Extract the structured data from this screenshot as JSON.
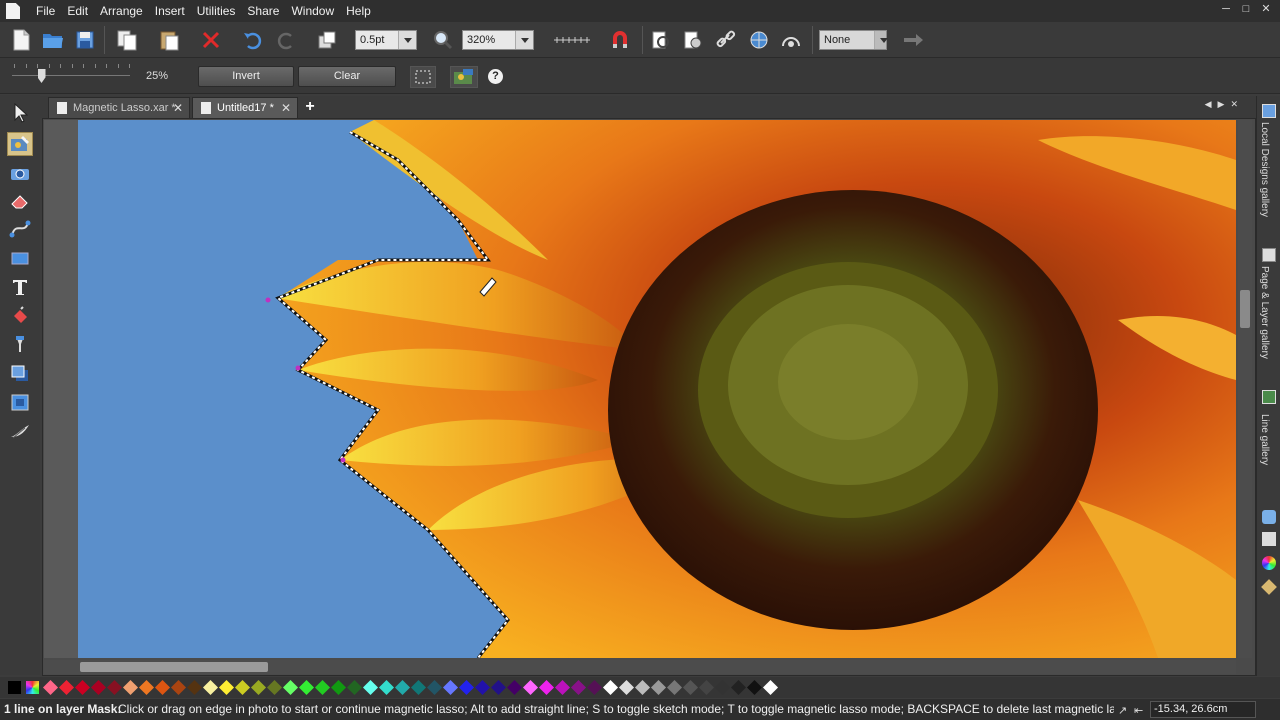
{
  "menu": [
    "File",
    "Edit",
    "Arrange",
    "Insert",
    "Utilities",
    "Share",
    "Window",
    "Help"
  ],
  "toolbar": {
    "line_width": "0.5pt",
    "zoom": "320%",
    "fill_none": "None"
  },
  "lasso_options": {
    "feather_value": 0.25,
    "feather_label": "25%",
    "invert_label": "Invert",
    "clear_label": "Clear",
    "help_glyph": "?"
  },
  "tabs": [
    {
      "label": "Magnetic Lasso.xar *"
    },
    {
      "label": "Untitled17 *"
    }
  ],
  "add_tab_glyph": "+",
  "galleries": {
    "local_designs": "Local Designs gallery",
    "page_layer": "Page & Layer gallery",
    "line": "Line gallery"
  },
  "palette_colors": [
    "#000000",
    "#e8e8e8",
    "#ff6688",
    "#ee2233",
    "#cc0022",
    "#aa0022",
    "#881122",
    "#f0a070",
    "#ee7722",
    "#dd5511",
    "#aa4411",
    "#553311",
    "#f8f0a0",
    "#ffee33",
    "#cccc22",
    "#99aa22",
    "#667722",
    "#66ff66",
    "#33ee33",
    "#22cc22",
    "#119911",
    "#226622",
    "#66ffee",
    "#33ddcc",
    "#22aaaa",
    "#117777",
    "#225566",
    "#6677ff",
    "#2222ee",
    "#2211aa",
    "#221188",
    "#440066",
    "#ff66ff",
    "#ee22ee",
    "#bb11bb",
    "#881188",
    "#551155",
    "#ffffff",
    "#dddddd",
    "#bbbbbb",
    "#999999",
    "#777777",
    "#555555",
    "#444444",
    "#333333",
    "#222222",
    "#111111",
    "#ffffff"
  ],
  "status": {
    "layer": "1 line on layer Mask:",
    "message": "Click or drag on edge in photo to start or continue magnetic lasso; Alt to add straight line; S to toggle sketch mode; T to toggle magnetic lasso mode; BACKSPACE to delete last magnetic lasso",
    "coords": "-15.34, 26.6cm"
  }
}
